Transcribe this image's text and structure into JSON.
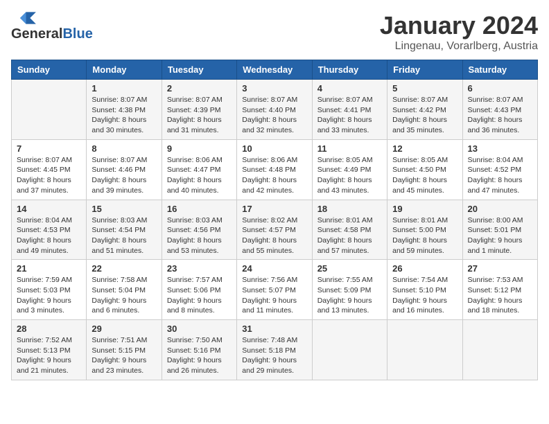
{
  "header": {
    "logo_general": "General",
    "logo_blue": "Blue",
    "title": "January 2024",
    "location": "Lingenau, Vorarlberg, Austria"
  },
  "days_of_week": [
    "Sunday",
    "Monday",
    "Tuesday",
    "Wednesday",
    "Thursday",
    "Friday",
    "Saturday"
  ],
  "weeks": [
    [
      {
        "day": "",
        "info": ""
      },
      {
        "day": "1",
        "info": "Sunrise: 8:07 AM\nSunset: 4:38 PM\nDaylight: 8 hours\nand 30 minutes."
      },
      {
        "day": "2",
        "info": "Sunrise: 8:07 AM\nSunset: 4:39 PM\nDaylight: 8 hours\nand 31 minutes."
      },
      {
        "day": "3",
        "info": "Sunrise: 8:07 AM\nSunset: 4:40 PM\nDaylight: 8 hours\nand 32 minutes."
      },
      {
        "day": "4",
        "info": "Sunrise: 8:07 AM\nSunset: 4:41 PM\nDaylight: 8 hours\nand 33 minutes."
      },
      {
        "day": "5",
        "info": "Sunrise: 8:07 AM\nSunset: 4:42 PM\nDaylight: 8 hours\nand 35 minutes."
      },
      {
        "day": "6",
        "info": "Sunrise: 8:07 AM\nSunset: 4:43 PM\nDaylight: 8 hours\nand 36 minutes."
      }
    ],
    [
      {
        "day": "7",
        "info": "Sunrise: 8:07 AM\nSunset: 4:45 PM\nDaylight: 8 hours\nand 37 minutes."
      },
      {
        "day": "8",
        "info": "Sunrise: 8:07 AM\nSunset: 4:46 PM\nDaylight: 8 hours\nand 39 minutes."
      },
      {
        "day": "9",
        "info": "Sunrise: 8:06 AM\nSunset: 4:47 PM\nDaylight: 8 hours\nand 40 minutes."
      },
      {
        "day": "10",
        "info": "Sunrise: 8:06 AM\nSunset: 4:48 PM\nDaylight: 8 hours\nand 42 minutes."
      },
      {
        "day": "11",
        "info": "Sunrise: 8:05 AM\nSunset: 4:49 PM\nDaylight: 8 hours\nand 43 minutes."
      },
      {
        "day": "12",
        "info": "Sunrise: 8:05 AM\nSunset: 4:50 PM\nDaylight: 8 hours\nand 45 minutes."
      },
      {
        "day": "13",
        "info": "Sunrise: 8:04 AM\nSunset: 4:52 PM\nDaylight: 8 hours\nand 47 minutes."
      }
    ],
    [
      {
        "day": "14",
        "info": "Sunrise: 8:04 AM\nSunset: 4:53 PM\nDaylight: 8 hours\nand 49 minutes."
      },
      {
        "day": "15",
        "info": "Sunrise: 8:03 AM\nSunset: 4:54 PM\nDaylight: 8 hours\nand 51 minutes."
      },
      {
        "day": "16",
        "info": "Sunrise: 8:03 AM\nSunset: 4:56 PM\nDaylight: 8 hours\nand 53 minutes."
      },
      {
        "day": "17",
        "info": "Sunrise: 8:02 AM\nSunset: 4:57 PM\nDaylight: 8 hours\nand 55 minutes."
      },
      {
        "day": "18",
        "info": "Sunrise: 8:01 AM\nSunset: 4:58 PM\nDaylight: 8 hours\nand 57 minutes."
      },
      {
        "day": "19",
        "info": "Sunrise: 8:01 AM\nSunset: 5:00 PM\nDaylight: 8 hours\nand 59 minutes."
      },
      {
        "day": "20",
        "info": "Sunrise: 8:00 AM\nSunset: 5:01 PM\nDaylight: 9 hours\nand 1 minute."
      }
    ],
    [
      {
        "day": "21",
        "info": "Sunrise: 7:59 AM\nSunset: 5:03 PM\nDaylight: 9 hours\nand 3 minutes."
      },
      {
        "day": "22",
        "info": "Sunrise: 7:58 AM\nSunset: 5:04 PM\nDaylight: 9 hours\nand 6 minutes."
      },
      {
        "day": "23",
        "info": "Sunrise: 7:57 AM\nSunset: 5:06 PM\nDaylight: 9 hours\nand 8 minutes."
      },
      {
        "day": "24",
        "info": "Sunrise: 7:56 AM\nSunset: 5:07 PM\nDaylight: 9 hours\nand 11 minutes."
      },
      {
        "day": "25",
        "info": "Sunrise: 7:55 AM\nSunset: 5:09 PM\nDaylight: 9 hours\nand 13 minutes."
      },
      {
        "day": "26",
        "info": "Sunrise: 7:54 AM\nSunset: 5:10 PM\nDaylight: 9 hours\nand 16 minutes."
      },
      {
        "day": "27",
        "info": "Sunrise: 7:53 AM\nSunset: 5:12 PM\nDaylight: 9 hours\nand 18 minutes."
      }
    ],
    [
      {
        "day": "28",
        "info": "Sunrise: 7:52 AM\nSunset: 5:13 PM\nDaylight: 9 hours\nand 21 minutes."
      },
      {
        "day": "29",
        "info": "Sunrise: 7:51 AM\nSunset: 5:15 PM\nDaylight: 9 hours\nand 23 minutes."
      },
      {
        "day": "30",
        "info": "Sunrise: 7:50 AM\nSunset: 5:16 PM\nDaylight: 9 hours\nand 26 minutes."
      },
      {
        "day": "31",
        "info": "Sunrise: 7:48 AM\nSunset: 5:18 PM\nDaylight: 9 hours\nand 29 minutes."
      },
      {
        "day": "",
        "info": ""
      },
      {
        "day": "",
        "info": ""
      },
      {
        "day": "",
        "info": ""
      }
    ]
  ]
}
